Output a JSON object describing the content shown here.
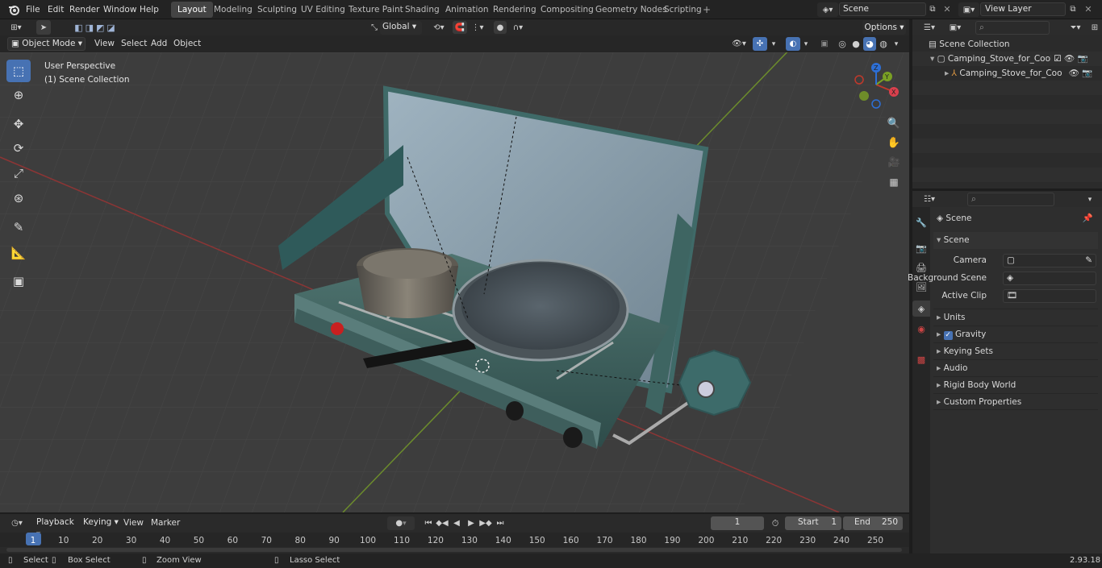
{
  "menu": [
    "File",
    "Edit",
    "Render",
    "Window",
    "Help"
  ],
  "workspaces": [
    "Layout",
    "Modeling",
    "Sculpting",
    "UV Editing",
    "Texture Paint",
    "Shading",
    "Animation",
    "Rendering",
    "Compositing",
    "Geometry Nodes",
    "Scripting"
  ],
  "scene_field": "Scene",
  "view_layer_field": "View Layer",
  "viewport_header": {
    "mode": "Object Mode",
    "menus": [
      "View",
      "Select",
      "Add",
      "Object"
    ],
    "orientation": "Global",
    "options": "Options"
  },
  "viewport_overlay": {
    "line1": "User Perspective",
    "line2": "(1) Scene Collection"
  },
  "outliner": {
    "root": "Scene Collection",
    "items": [
      "Camping_Stove_for_Cooking_",
      "Camping_Stove_for_Coo"
    ]
  },
  "properties": {
    "title": "Scene",
    "section": "Scene",
    "fields": [
      {
        "label": "Camera",
        "value": ""
      },
      {
        "label": "Background Scene",
        "value": ""
      },
      {
        "label": "Active Clip",
        "value": ""
      }
    ],
    "collapsed": [
      "Units",
      "Gravity",
      "Keying Sets",
      "Audio",
      "Rigid Body World",
      "Custom Properties"
    ]
  },
  "timeline": {
    "menus": [
      "Playback",
      "Keying",
      "View",
      "Marker"
    ],
    "current_frame": "1",
    "start_label": "Start",
    "start": "1",
    "end_label": "End",
    "end": "250",
    "ticks": [
      "1",
      "10",
      "20",
      "30",
      "40",
      "50",
      "60",
      "70",
      "80",
      "90",
      "100",
      "110",
      "120",
      "130",
      "140",
      "150",
      "160",
      "170",
      "180",
      "190",
      "200",
      "210",
      "220",
      "230",
      "240",
      "250"
    ]
  },
  "statusbar": {
    "select": "Select",
    "box": "Box Select",
    "zoom": "Zoom View",
    "lasso": "Lasso Select",
    "version": "2.93.18"
  },
  "colors": {
    "accent": "#4772b3",
    "x_axis": "#c0392b",
    "y_axis": "#7aa024",
    "z_axis": "#2d6fd6"
  }
}
